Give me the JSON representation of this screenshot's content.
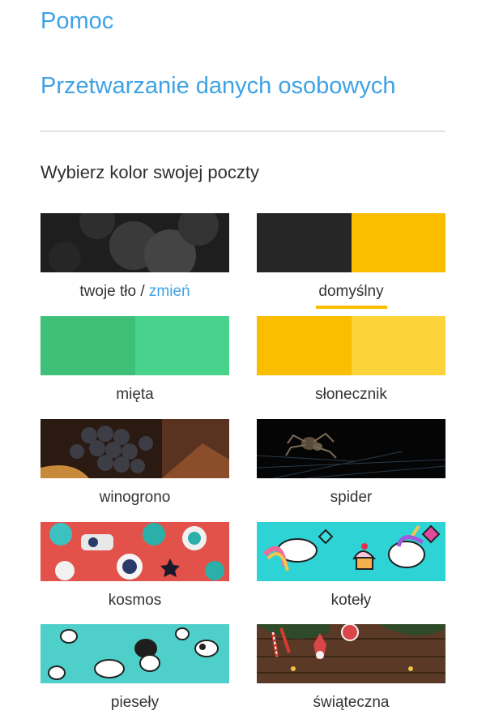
{
  "links": {
    "help": "Pomoc",
    "privacy": "Przetwarzanie danych osobowych"
  },
  "section": {
    "title": "Wybierz kolor swojej poczty"
  },
  "themes": [
    {
      "label": "twoje tło",
      "separator": "/",
      "action": "zmień",
      "type": "image"
    },
    {
      "label": "domyślny",
      "selected": true,
      "colors": [
        "#262626",
        "#fbbd00"
      ]
    },
    {
      "label": "mięta",
      "colors": [
        "#3ec078",
        "#47d38b"
      ]
    },
    {
      "label": "słonecznik",
      "colors": [
        "#fbbd00",
        "#fcd43a"
      ]
    },
    {
      "label": "winogrono",
      "type": "image"
    },
    {
      "label": "spider",
      "type": "image"
    },
    {
      "label": "kosmos",
      "type": "image"
    },
    {
      "label": "koteły",
      "type": "image"
    },
    {
      "label": "pieseły",
      "type": "image"
    },
    {
      "label": "świąteczna",
      "type": "image"
    }
  ],
  "colors": {
    "accent": "#3ea2e5",
    "selected_underline": "#fbbd00"
  }
}
